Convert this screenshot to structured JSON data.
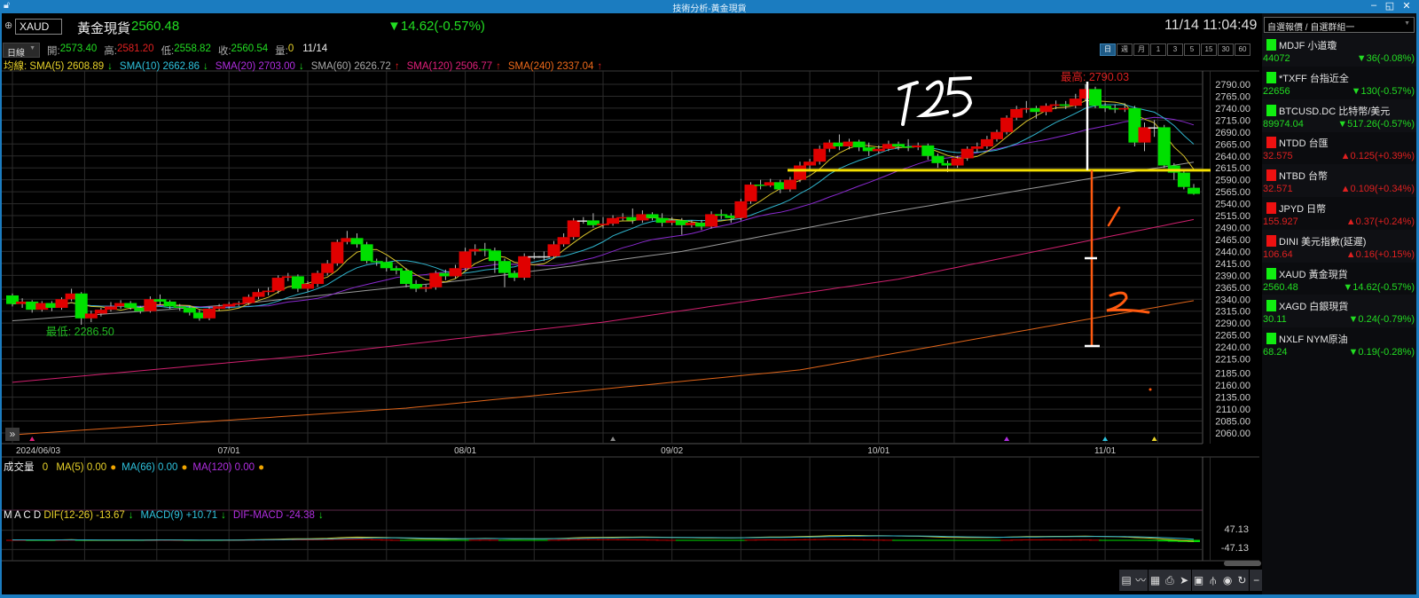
{
  "window": {
    "title": "技術分析-黃金現貨",
    "minimize": "–",
    "restore": "◱",
    "close": "✕"
  },
  "header": {
    "symbol": "XAUD",
    "name": "黃金現貨",
    "price": "2560.48",
    "change": "▼14.62(-0.57%)",
    "datetime": "11/14 11:04:49"
  },
  "ohlc_row": {
    "period": "日線",
    "open_label": "開:",
    "open": "2573.40",
    "high_label": "高:",
    "high": "2581.20",
    "low_label": "低:",
    "low": "2558.82",
    "close_label": "收:",
    "close": "2560.54",
    "vol_label": "量:",
    "vol": "0",
    "date": "11/14"
  },
  "period_buttons": [
    "日",
    "週",
    "月",
    "1",
    "3",
    "5",
    "15",
    "30",
    "60"
  ],
  "ma_legend": {
    "label": "均線:",
    "items": [
      {
        "text": "SMA(5) 2608.89",
        "arrow": "↓",
        "color": "#e8d22a",
        "arrow_color": "#22dd22"
      },
      {
        "text": "SMA(10) 2662.86",
        "arrow": "↓",
        "color": "#2fc3de",
        "arrow_color": "#22dd22"
      },
      {
        "text": "SMA(20) 2703.00",
        "arrow": "↓",
        "color": "#b02ee0",
        "arrow_color": "#22dd22"
      },
      {
        "text": "SMA(60) 2626.72",
        "arrow": "↑",
        "color": "#aaaaaa",
        "arrow_color": "#e02020"
      },
      {
        "text": "SMA(120) 2506.77",
        "arrow": "↑",
        "color": "#e0207a",
        "arrow_color": "#e02020"
      },
      {
        "text": "SMA(240) 2337.04",
        "arrow": "↑",
        "color": "#ef6a1a",
        "arrow_color": "#e02020"
      }
    ]
  },
  "volume_legend": {
    "label": "成交量",
    "value": "0",
    "items": [
      {
        "text": "MA(5) 0.00",
        "color": "#e8d22a"
      },
      {
        "text": "MA(66) 0.00",
        "color": "#2fc3de"
      },
      {
        "text": "MA(120) 0.00",
        "color": "#b02ee0"
      }
    ]
  },
  "macd_legend": {
    "label": "M A C D",
    "items": [
      {
        "text": "DIF(12-26) -13.67",
        "arrow": "↓",
        "color": "#e8d22a"
      },
      {
        "text": "MACD(9) +10.71",
        "arrow": "↓",
        "color": "#2fc3de"
      },
      {
        "text": "DIF-MACD -24.38",
        "arrow": "↓",
        "color": "#b02ee0"
      }
    ],
    "axis": [
      "47.13",
      "-47.13"
    ]
  },
  "chart_data": {
    "type": "candlestick",
    "colors": {
      "up": "#e00000",
      "down": "#00e000"
    },
    "ylim": [
      2060,
      2790
    ],
    "y_ticks": [
      2790,
      2765,
      2740,
      2715,
      2690,
      2665,
      2640,
      2615,
      2590,
      2565,
      2540,
      2515,
      2490,
      2465,
      2440,
      2415,
      2390,
      2365,
      2340,
      2315,
      2290,
      2265,
      2240,
      2215,
      2185,
      2160,
      2135,
      2110,
      2085,
      2060
    ],
    "y_tick_labels": [
      "2790.00",
      "2765.00",
      "2740.00",
      "2715.00",
      "2690.00",
      "2665.00",
      "2640.00",
      "2615.00",
      "2590.00",
      "2565.00",
      "2540.00",
      "2515.00",
      "2490.00",
      "2465.00",
      "2440.00",
      "2415.00",
      "2390.00",
      "2365.00",
      "2340.00",
      "2315.00",
      "2290.00",
      "2265.00",
      "2240.00",
      "2215.00",
      "2185.00",
      "2160.00",
      "2135.00",
      "2110.00",
      "2085.00",
      "2060.00"
    ],
    "x_labels": [
      {
        "index": 0,
        "text": "2024/06/03"
      },
      {
        "index": 22,
        "text": "07/01"
      },
      {
        "index": 46,
        "text": "08/01"
      },
      {
        "index": 67,
        "text": "09/02"
      },
      {
        "index": 88,
        "text": "10/01"
      },
      {
        "index": 111,
        "text": "11/01"
      }
    ],
    "open": [
      2348,
      2330,
      2335,
      2318,
      2332,
      2322,
      2340,
      2352,
      2300,
      2310,
      2318,
      2325,
      2332,
      2322,
      2315,
      2340,
      2335,
      2325,
      2322,
      2312,
      2300,
      2320,
      2325,
      2330,
      2332,
      2345,
      2355,
      2358,
      2385,
      2388,
      2362,
      2372,
      2395,
      2415,
      2460,
      2468,
      2455,
      2420,
      2418,
      2405,
      2400,
      2372,
      2362,
      2365,
      2395,
      2388,
      2405,
      2440,
      2445,
      2442,
      2420,
      2395,
      2385,
      2430,
      2430,
      2430,
      2455,
      2470,
      2505,
      2505,
      2495,
      2498,
      2510,
      2512,
      2505,
      2518,
      2510,
      2500,
      2505,
      2495,
      2500,
      2492,
      2518,
      2515,
      2510,
      2545,
      2580,
      2578,
      2585,
      2570,
      2590,
      2620,
      2628,
      2655,
      2668,
      2660,
      2670,
      2658,
      2650,
      2655,
      2665,
      2660,
      2658,
      2662,
      2640,
      2625,
      2620,
      2635,
      2655,
      2660,
      2675,
      2690,
      2720,
      2738,
      2740,
      2732,
      2745,
      2748,
      2745,
      2760,
      2780,
      2745,
      2740,
      2738,
      2740,
      2668,
      2700,
      2700,
      2620,
      2605,
      2573.4
    ],
    "high": [
      2352,
      2342,
      2338,
      2336,
      2336,
      2344,
      2362,
      2355,
      2316,
      2322,
      2334,
      2338,
      2336,
      2326,
      2346,
      2350,
      2338,
      2330,
      2326,
      2318,
      2324,
      2330,
      2334,
      2336,
      2350,
      2362,
      2365,
      2390,
      2395,
      2392,
      2378,
      2400,
      2422,
      2465,
      2483,
      2478,
      2460,
      2425,
      2428,
      2410,
      2405,
      2380,
      2370,
      2400,
      2402,
      2412,
      2448,
      2455,
      2458,
      2448,
      2425,
      2400,
      2436,
      2438,
      2440,
      2462,
      2478,
      2510,
      2512,
      2520,
      2512,
      2516,
      2520,
      2530,
      2526,
      2522,
      2520,
      2512,
      2510,
      2505,
      2506,
      2524,
      2528,
      2520,
      2550,
      2585,
      2590,
      2592,
      2590,
      2596,
      2628,
      2634,
      2662,
      2674,
      2685,
      2676,
      2674,
      2668,
      2662,
      2672,
      2670,
      2675,
      2668,
      2666,
      2645,
      2630,
      2640,
      2660,
      2668,
      2682,
      2695,
      2725,
      2745,
      2755,
      2745,
      2750,
      2756,
      2755,
      2770,
      2790.03,
      2785,
      2752,
      2748,
      2750,
      2745,
      2710,
      2715,
      2705,
      2625,
      2610,
      2581.2
    ],
    "low": [
      2325,
      2322,
      2312,
      2314,
      2315,
      2318,
      2336,
      2286.5,
      2292,
      2304,
      2314,
      2320,
      2318,
      2310,
      2312,
      2328,
      2320,
      2316,
      2306,
      2295,
      2296,
      2316,
      2320,
      2326,
      2328,
      2340,
      2348,
      2352,
      2378,
      2355,
      2356,
      2366,
      2390,
      2410,
      2455,
      2448,
      2415,
      2410,
      2398,
      2392,
      2365,
      2355,
      2355,
      2360,
      2380,
      2384,
      2400,
      2432,
      2430,
      2395,
      2365,
      2378,
      2380,
      2424,
      2420,
      2425,
      2450,
      2465,
      2498,
      2490,
      2488,
      2494,
      2505,
      2498,
      2500,
      2505,
      2492,
      2495,
      2475,
      2490,
      2485,
      2488,
      2508,
      2500,
      2505,
      2540,
      2570,
      2575,
      2562,
      2565,
      2585,
      2612,
      2622,
      2648,
      2652,
      2654,
      2650,
      2640,
      2645,
      2650,
      2652,
      2650,
      2652,
      2632,
      2615,
      2606,
      2615,
      2630,
      2648,
      2655,
      2670,
      2685,
      2715,
      2730,
      2718,
      2725,
      2738,
      2738,
      2740,
      2755,
      2740,
      2732,
      2730,
      2732,
      2660,
      2650,
      2680,
      2615,
      2590,
      2570,
      2558.82
    ],
    "close": [
      2330,
      2335,
      2318,
      2332,
      2322,
      2340,
      2352,
      2300,
      2310,
      2318,
      2325,
      2332,
      2322,
      2315,
      2340,
      2335,
      2325,
      2322,
      2312,
      2300,
      2320,
      2325,
      2330,
      2332,
      2345,
      2355,
      2358,
      2385,
      2388,
      2362,
      2372,
      2395,
      2415,
      2460,
      2468,
      2455,
      2420,
      2418,
      2405,
      2400,
      2372,
      2362,
      2365,
      2395,
      2388,
      2405,
      2440,
      2445,
      2442,
      2420,
      2395,
      2385,
      2430,
      2430,
      2430,
      2455,
      2470,
      2505,
      2505,
      2495,
      2498,
      2510,
      2512,
      2505,
      2518,
      2510,
      2500,
      2505,
      2495,
      2500,
      2492,
      2518,
      2515,
      2510,
      2545,
      2580,
      2578,
      2585,
      2570,
      2590,
      2620,
      2628,
      2655,
      2668,
      2660,
      2670,
      2658,
      2650,
      2655,
      2665,
      2660,
      2658,
      2662,
      2640,
      2625,
      2620,
      2635,
      2655,
      2660,
      2675,
      2690,
      2720,
      2738,
      2740,
      2732,
      2745,
      2748,
      2745,
      2760,
      2780,
      2745,
      2740,
      2738,
      2740,
      2668,
      2700,
      2700,
      2620,
      2605,
      2575,
      2560.54
    ],
    "long_ma": [
      {
        "name": "SMA(60)",
        "color": "#9a9a9a",
        "points": [
          [
            0,
            2295
          ],
          [
            22,
            2328
          ],
          [
            46,
            2380
          ],
          [
            68,
            2440
          ],
          [
            88,
            2518
          ],
          [
            111,
            2598
          ],
          [
            120,
            2627
          ]
        ]
      },
      {
        "name": "SMA(120)",
        "color": "#d0206e",
        "points": [
          [
            0,
            2166
          ],
          [
            30,
            2222
          ],
          [
            60,
            2292
          ],
          [
            90,
            2382
          ],
          [
            120,
            2507
          ]
        ]
      },
      {
        "name": "SMA(240)",
        "color": "#e0651a",
        "points": [
          [
            0,
            2056
          ],
          [
            40,
            2112
          ],
          [
            80,
            2192
          ],
          [
            120,
            2337
          ]
        ]
      }
    ],
    "annotations": {
      "max_label": "最高: 2790.03",
      "max_index": 109,
      "max_value": 2790.03,
      "min_label": "最低: 2286.50",
      "min_index": 7,
      "min_value": 2286.5,
      "support_line": 2610,
      "handwriting": [
        "125",
        "1",
        "2"
      ]
    },
    "event_markers": [
      {
        "index": 2,
        "color": "#e0207a"
      },
      {
        "index": 61,
        "color": "#888888"
      },
      {
        "index": 101,
        "color": "#b02ee0"
      },
      {
        "index": 111,
        "color": "#2fc3de"
      },
      {
        "index": 116,
        "color": "#e8d22a"
      }
    ]
  },
  "watchlist": {
    "header": "自選報價 / 自選群組一",
    "items": [
      {
        "name": "MDJF 小道瓊",
        "price": "44072",
        "change": "▼36(-0.08%)",
        "dir": "down"
      },
      {
        "name": "*TXFF 台指近全",
        "price": "22656",
        "change": "▼130(-0.57%)",
        "dir": "down"
      },
      {
        "name": "BTCUSD.DC 比特幣/美元",
        "price": "89974.04",
        "change": "▼517.26(-0.57%)",
        "dir": "down"
      },
      {
        "name": "NTDD 台匯",
        "price": "32.575",
        "change": "▲0.125(+0.39%)",
        "dir": "up"
      },
      {
        "name": "NTBD 台幣",
        "price": "32.571",
        "change": "▲0.109(+0.34%)",
        "dir": "up"
      },
      {
        "name": "JPYD 日幣",
        "price": "155.927",
        "change": "▲0.37(+0.24%)",
        "dir": "up"
      },
      {
        "name": "DINI 美元指數(延遲)",
        "price": "106.64",
        "change": "▲0.16(+0.15%)",
        "dir": "up"
      },
      {
        "name": "XAUD 黃金現貨",
        "price": "2560.48",
        "change": "▼14.62(-0.57%)",
        "dir": "down"
      },
      {
        "name": "XAGD 白銀現貨",
        "price": "30.11",
        "change": "▼0.24(-0.79%)",
        "dir": "down"
      },
      {
        "name": "NXLF NYM原油",
        "price": "68.24",
        "change": "▼0.19(-0.28%)",
        "dir": "down"
      }
    ]
  },
  "toolbar": [
    {
      "name": "document-icon",
      "glyph": "▤"
    },
    {
      "name": "draw-line-icon",
      "glyph": "〰"
    },
    {
      "name": "zoom-table-icon",
      "glyph": "▦"
    },
    {
      "name": "print-icon",
      "glyph": "⎙"
    },
    {
      "name": "cursor-icon",
      "glyph": "➤"
    },
    {
      "name": "layout-icon",
      "glyph": "▣"
    },
    {
      "name": "indicator-icon",
      "glyph": "⫛"
    },
    {
      "name": "eye-icon",
      "glyph": "◉"
    },
    {
      "name": "refresh-icon",
      "glyph": "↻"
    },
    {
      "name": "zoom-out-icon",
      "glyph": "−"
    },
    {
      "name": "zoom-in-icon",
      "glyph": "+"
    }
  ],
  "expand_glyph": "»"
}
